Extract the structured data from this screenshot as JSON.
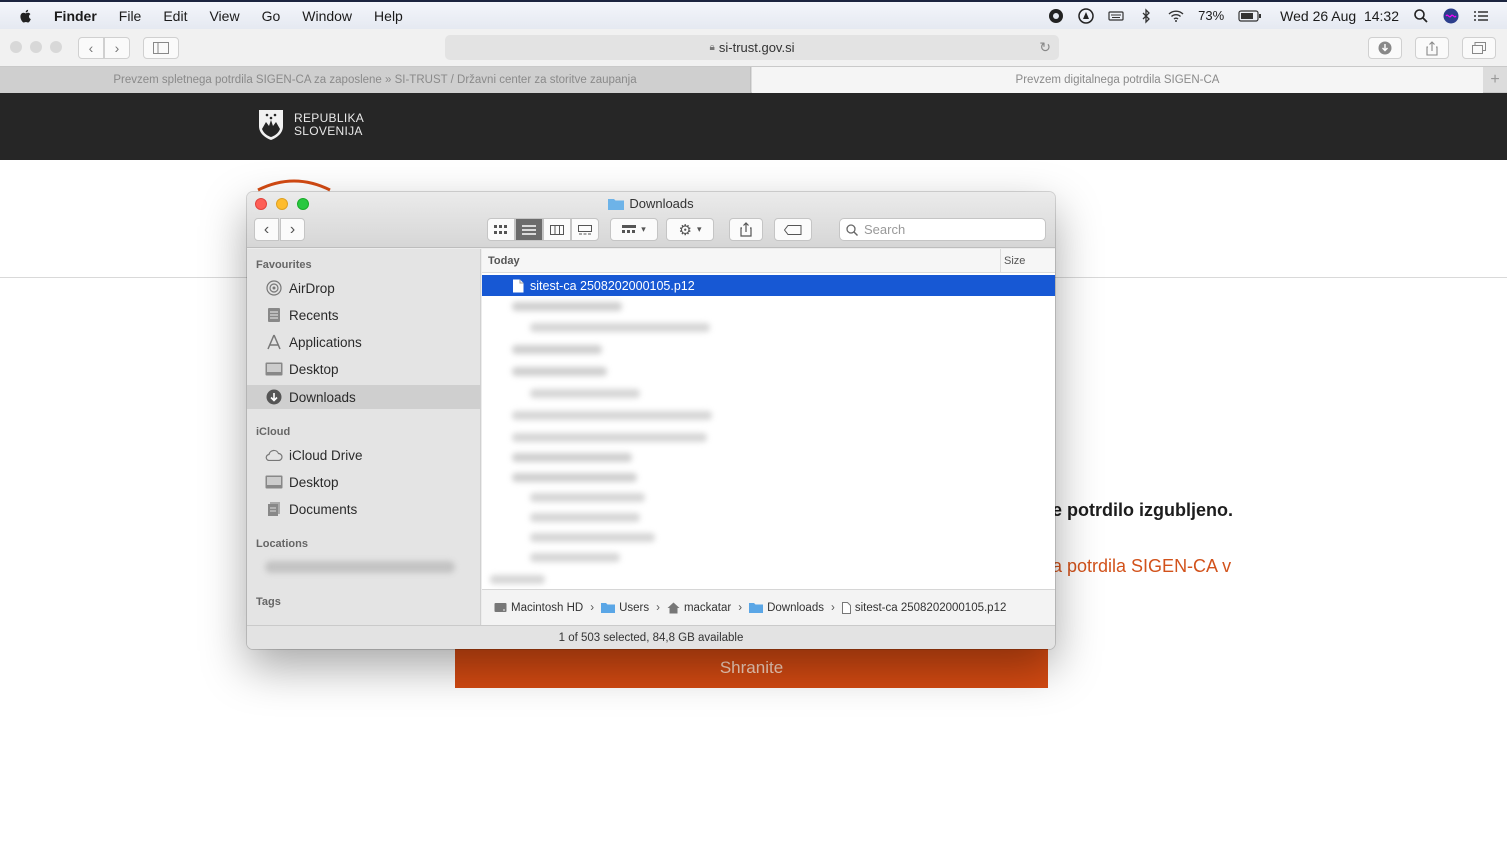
{
  "menubar": {
    "app": "Finder",
    "items": [
      "File",
      "Edit",
      "View",
      "Go",
      "Window",
      "Help"
    ],
    "battery": "73%",
    "datetime": "Wed 26 Aug  14:32"
  },
  "browser": {
    "url": "si-trust.gov.si",
    "tabs": [
      {
        "label": "Prevzem spletnega potrdila SIGEN-CA za zaposlene » SI-TRUST / Državni center za storitve zaupanja"
      },
      {
        "label": "Prevzem digitalnega potrdila SIGEN-CA"
      }
    ],
    "new_tab": "+"
  },
  "site": {
    "logo_line1": "REPUBLIKA",
    "logo_line2": "SLOVENIJA",
    "lost_text": "e potrdilo izgubljeno.",
    "orange_text": "a potrdila SIGEN-CA v",
    "save_button": "Shranite"
  },
  "finder": {
    "title": "Downloads",
    "search_placeholder": "Search",
    "sidebar": {
      "favourites_heading": "Favourites",
      "favourites": [
        {
          "label": "AirDrop",
          "icon": "airdrop-icon"
        },
        {
          "label": "Recents",
          "icon": "recents-icon"
        },
        {
          "label": "Applications",
          "icon": "applications-icon"
        },
        {
          "label": "Desktop",
          "icon": "desktop-icon"
        },
        {
          "label": "Downloads",
          "icon": "downloads-icon",
          "selected": true
        }
      ],
      "icloud_heading": "iCloud",
      "icloud": [
        {
          "label": "iCloud Drive",
          "icon": "cloud-icon"
        },
        {
          "label": "Desktop",
          "icon": "desktop-icon"
        },
        {
          "label": "Documents",
          "icon": "documents-icon"
        }
      ],
      "locations_heading": "Locations",
      "tags_heading": "Tags"
    },
    "list": {
      "header_group": "Today",
      "header_size": "Size",
      "selected_file": "sitest-ca 2508202000105.p12"
    },
    "pathbar": [
      "Macintosh HD",
      "Users",
      "mackatar",
      "Downloads",
      "sitest-ca 2508202000105.p12"
    ],
    "status": "1 of 503 selected, 84,8 GB available"
  },
  "colors": {
    "selection": "#1758d4",
    "accent": "#d44a12",
    "header_bg": "#262626"
  }
}
